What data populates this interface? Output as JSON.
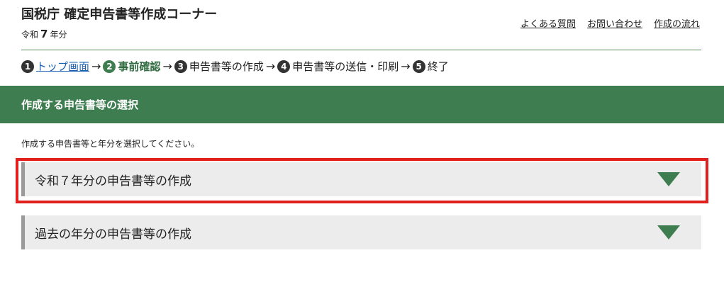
{
  "header": {
    "site_title": "国税庁 確定申告書等作成コーナー",
    "year_prefix": "令和",
    "year_number": "7",
    "year_suffix": "年分",
    "links": [
      "よくある質問",
      "お問い合わせ",
      "作成の流れ"
    ]
  },
  "steps": [
    {
      "num": "1",
      "label": "トップ画面",
      "link": true
    },
    {
      "num": "2",
      "label": "事前確認",
      "current": true
    },
    {
      "num": "3",
      "label": "申告書等の作成"
    },
    {
      "num": "4",
      "label": "申告書等の送信・印刷"
    },
    {
      "num": "5",
      "label": "終了"
    }
  ],
  "step_arrow": "→",
  "section": {
    "title": "作成する申告書等の選択",
    "instruction": "作成する申告書等と年分を選択してください。"
  },
  "accordions": [
    {
      "label": "令和７年分の申告書等の作成",
      "icon": "triangle-down-icon"
    },
    {
      "label": "過去の年分の申告書等の作成",
      "icon": "triangle-down-icon"
    }
  ],
  "colors": {
    "accent_green": "#3e7d50",
    "highlight_red": "#e0201c",
    "accordion_bg": "#ececec"
  }
}
